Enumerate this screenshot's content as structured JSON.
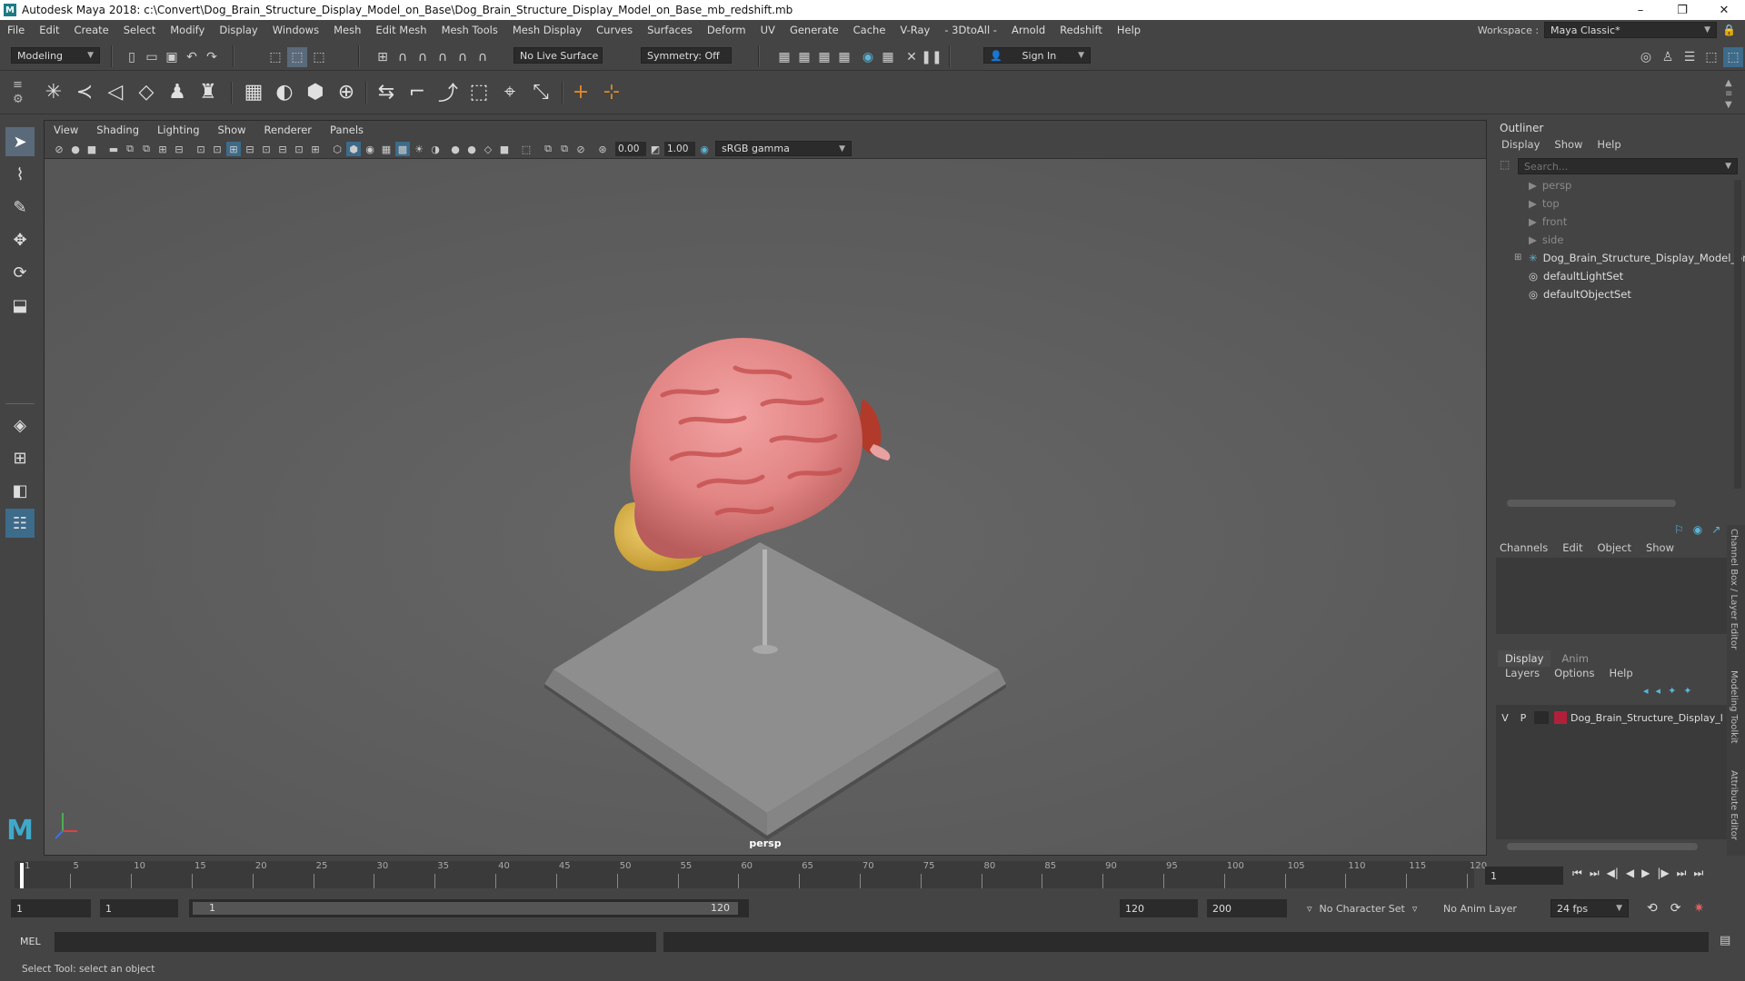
{
  "window": {
    "title": "Autodesk Maya 2018: c:\\Convert\\Dog_Brain_Structure_Display_Model_on_Base\\Dog_Brain_Structure_Display_Model_on_Base_mb_redshift.mb",
    "minimize": "–",
    "maximize": "❐",
    "close": "✕"
  },
  "menubar": {
    "items": [
      "File",
      "Edit",
      "Create",
      "Select",
      "Modify",
      "Display",
      "Windows",
      "Mesh",
      "Edit Mesh",
      "Mesh Tools",
      "Mesh Display",
      "Curves",
      "Surfaces",
      "Deform",
      "UV",
      "Generate",
      "Cache",
      "V-Ray",
      "- 3DtoAll -",
      "Arnold",
      "Redshift",
      "Help"
    ],
    "workspace_label": "Workspace :",
    "workspace_value": "Maya Classic*"
  },
  "statusline": {
    "mode": "Modeling",
    "live_surface": "No Live Surface",
    "symmetry": "Symmetry: Off",
    "sign_in": "Sign In"
  },
  "viewport": {
    "menu": [
      "View",
      "Shading",
      "Lighting",
      "Show",
      "Renderer",
      "Panels"
    ],
    "exposure": "0.00",
    "gamma": "1.00",
    "color_space": "sRGB gamma",
    "camera": "persp"
  },
  "outliner": {
    "title": "Outliner",
    "menu": [
      "Display",
      "Show",
      "Help"
    ],
    "search_placeholder": "Search...",
    "items": [
      {
        "label": "persp",
        "icon": "camera-icon",
        "dim": true
      },
      {
        "label": "top",
        "icon": "camera-icon",
        "dim": true
      },
      {
        "label": "front",
        "icon": "camera-icon",
        "dim": true
      },
      {
        "label": "side",
        "icon": "camera-icon",
        "dim": true
      },
      {
        "label": "Dog_Brain_Structure_Display_Model_on",
        "icon": "group-icon",
        "dim": false
      },
      {
        "label": "defaultLightSet",
        "icon": "set-icon",
        "dim": false
      },
      {
        "label": "defaultObjectSet",
        "icon": "set-icon",
        "dim": false
      }
    ]
  },
  "channel_box": {
    "menu": [
      "Channels",
      "Edit",
      "Object",
      "Show"
    ]
  },
  "layer_editor": {
    "tabs": [
      "Display",
      "Anim"
    ],
    "menu": [
      "Layers",
      "Options",
      "Help"
    ],
    "layer": {
      "v": "V",
      "p": "P",
      "name": "Dog_Brain_Structure_Display_l",
      "color": "#b0203a"
    }
  },
  "side_tabs": [
    "Channel Box / Layer Editor",
    "Modeling Toolkit",
    "Attribute Editor"
  ],
  "timeline": {
    "ticks": [
      "1",
      "5",
      "10",
      "15",
      "20",
      "25",
      "30",
      "35",
      "40",
      "45",
      "50",
      "55",
      "60",
      "65",
      "70",
      "75",
      "80",
      "85",
      "90",
      "95",
      "100",
      "105",
      "110",
      "115",
      "120"
    ],
    "current_frame": "1"
  },
  "range": {
    "start": "1",
    "playback_start": "1",
    "slider_start": "1",
    "slider_end": "120",
    "playback_end": "120",
    "end": "200",
    "character_set": "No Character Set",
    "anim_layer": "No Anim Layer",
    "fps": "24 fps"
  },
  "command": {
    "lang": "MEL"
  },
  "help_line": "Select Tool: select an object",
  "colors": {
    "accent": "#5bb5d8",
    "layer_color": "#b0203a"
  }
}
